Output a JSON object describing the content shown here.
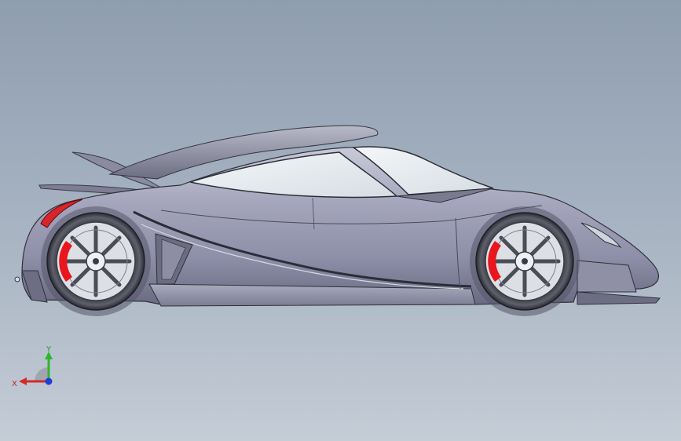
{
  "viewport": {
    "background_top": "#8f9db0",
    "background_bottom": "#c4ccd6"
  },
  "model": {
    "body_color": "#9c9db4",
    "body_shadow": "#6e6f88",
    "glass_color": "#e9eef2",
    "caliper_color": "#e8161d",
    "wheel_color": "#dcdfe4"
  },
  "triad": {
    "y_label": "Y",
    "x_label": "X",
    "y_color": "#2fb52f",
    "x_color": "#d32a2a",
    "z_color": "#1c3fd6"
  }
}
